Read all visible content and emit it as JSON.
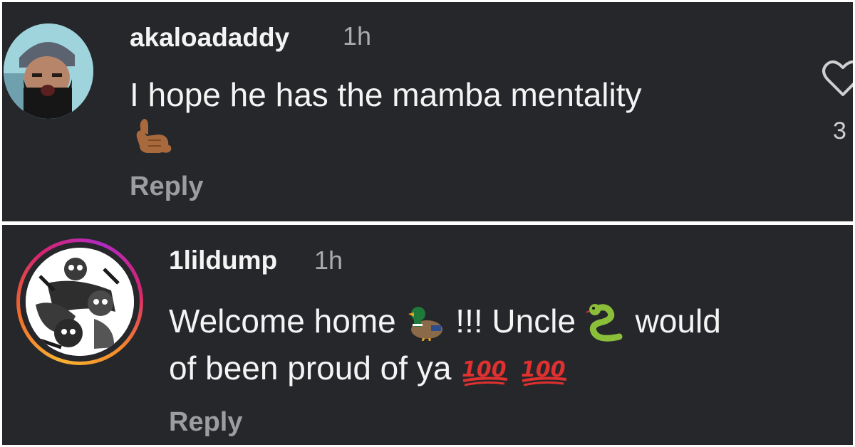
{
  "comments": [
    {
      "username": "akaloadaddy",
      "time": "1h",
      "text": "I hope he has the mamba mentality",
      "emoji_line": [
        "call-me-hand-emoji"
      ],
      "reply_label": "Reply",
      "like_count": "3"
    },
    {
      "username": "1lildump",
      "time": "1h",
      "text_parts": [
        "Welcome home",
        "!!! Uncle",
        "would",
        "of been proud of ya"
      ],
      "emojis": [
        "duck-emoji",
        "snake-emoji",
        "hundred-points-emoji"
      ],
      "reply_label": "Reply"
    }
  ],
  "colors": {
    "background": "#26272b",
    "text": "#f4f4f4",
    "muted": "#a9abae",
    "hundred_red": "#e0302f"
  }
}
